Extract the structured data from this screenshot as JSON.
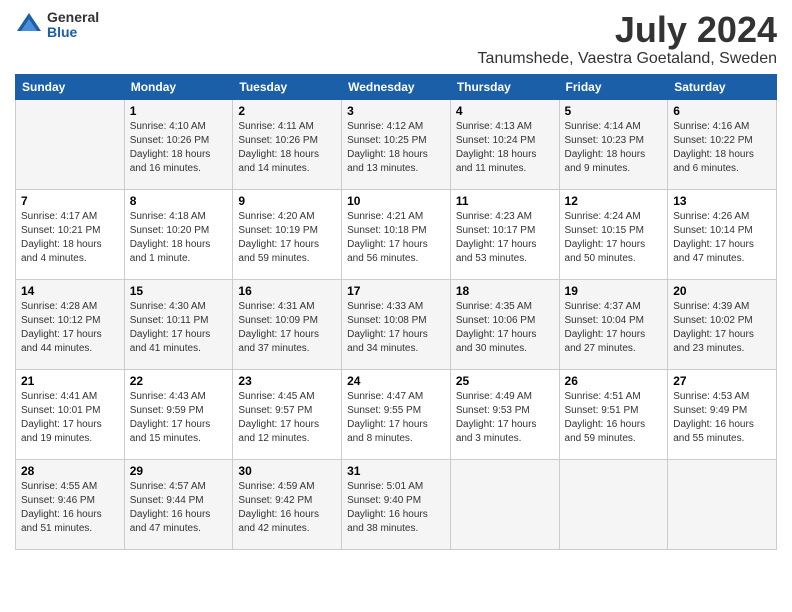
{
  "logo": {
    "general": "General",
    "blue": "Blue"
  },
  "title": {
    "month": "July 2024",
    "location": "Tanumshede, Vaestra Goetaland, Sweden"
  },
  "weekdays": [
    "Sunday",
    "Monday",
    "Tuesday",
    "Wednesday",
    "Thursday",
    "Friday",
    "Saturday"
  ],
  "weeks": [
    [
      {
        "day": "",
        "info": ""
      },
      {
        "day": "1",
        "info": "Sunrise: 4:10 AM\nSunset: 10:26 PM\nDaylight: 18 hours\nand 16 minutes."
      },
      {
        "day": "2",
        "info": "Sunrise: 4:11 AM\nSunset: 10:26 PM\nDaylight: 18 hours\nand 14 minutes."
      },
      {
        "day": "3",
        "info": "Sunrise: 4:12 AM\nSunset: 10:25 PM\nDaylight: 18 hours\nand 13 minutes."
      },
      {
        "day": "4",
        "info": "Sunrise: 4:13 AM\nSunset: 10:24 PM\nDaylight: 18 hours\nand 11 minutes."
      },
      {
        "day": "5",
        "info": "Sunrise: 4:14 AM\nSunset: 10:23 PM\nDaylight: 18 hours\nand 9 minutes."
      },
      {
        "day": "6",
        "info": "Sunrise: 4:16 AM\nSunset: 10:22 PM\nDaylight: 18 hours\nand 6 minutes."
      }
    ],
    [
      {
        "day": "7",
        "info": "Sunrise: 4:17 AM\nSunset: 10:21 PM\nDaylight: 18 hours\nand 4 minutes."
      },
      {
        "day": "8",
        "info": "Sunrise: 4:18 AM\nSunset: 10:20 PM\nDaylight: 18 hours\nand 1 minute."
      },
      {
        "day": "9",
        "info": "Sunrise: 4:20 AM\nSunset: 10:19 PM\nDaylight: 17 hours\nand 59 minutes."
      },
      {
        "day": "10",
        "info": "Sunrise: 4:21 AM\nSunset: 10:18 PM\nDaylight: 17 hours\nand 56 minutes."
      },
      {
        "day": "11",
        "info": "Sunrise: 4:23 AM\nSunset: 10:17 PM\nDaylight: 17 hours\nand 53 minutes."
      },
      {
        "day": "12",
        "info": "Sunrise: 4:24 AM\nSunset: 10:15 PM\nDaylight: 17 hours\nand 50 minutes."
      },
      {
        "day": "13",
        "info": "Sunrise: 4:26 AM\nSunset: 10:14 PM\nDaylight: 17 hours\nand 47 minutes."
      }
    ],
    [
      {
        "day": "14",
        "info": "Sunrise: 4:28 AM\nSunset: 10:12 PM\nDaylight: 17 hours\nand 44 minutes."
      },
      {
        "day": "15",
        "info": "Sunrise: 4:30 AM\nSunset: 10:11 PM\nDaylight: 17 hours\nand 41 minutes."
      },
      {
        "day": "16",
        "info": "Sunrise: 4:31 AM\nSunset: 10:09 PM\nDaylight: 17 hours\nand 37 minutes."
      },
      {
        "day": "17",
        "info": "Sunrise: 4:33 AM\nSunset: 10:08 PM\nDaylight: 17 hours\nand 34 minutes."
      },
      {
        "day": "18",
        "info": "Sunrise: 4:35 AM\nSunset: 10:06 PM\nDaylight: 17 hours\nand 30 minutes."
      },
      {
        "day": "19",
        "info": "Sunrise: 4:37 AM\nSunset: 10:04 PM\nDaylight: 17 hours\nand 27 minutes."
      },
      {
        "day": "20",
        "info": "Sunrise: 4:39 AM\nSunset: 10:02 PM\nDaylight: 17 hours\nand 23 minutes."
      }
    ],
    [
      {
        "day": "21",
        "info": "Sunrise: 4:41 AM\nSunset: 10:01 PM\nDaylight: 17 hours\nand 19 minutes."
      },
      {
        "day": "22",
        "info": "Sunrise: 4:43 AM\nSunset: 9:59 PM\nDaylight: 17 hours\nand 15 minutes."
      },
      {
        "day": "23",
        "info": "Sunrise: 4:45 AM\nSunset: 9:57 PM\nDaylight: 17 hours\nand 12 minutes."
      },
      {
        "day": "24",
        "info": "Sunrise: 4:47 AM\nSunset: 9:55 PM\nDaylight: 17 hours\nand 8 minutes."
      },
      {
        "day": "25",
        "info": "Sunrise: 4:49 AM\nSunset: 9:53 PM\nDaylight: 17 hours\nand 3 minutes."
      },
      {
        "day": "26",
        "info": "Sunrise: 4:51 AM\nSunset: 9:51 PM\nDaylight: 16 hours\nand 59 minutes."
      },
      {
        "day": "27",
        "info": "Sunrise: 4:53 AM\nSunset: 9:49 PM\nDaylight: 16 hours\nand 55 minutes."
      }
    ],
    [
      {
        "day": "28",
        "info": "Sunrise: 4:55 AM\nSunset: 9:46 PM\nDaylight: 16 hours\nand 51 minutes."
      },
      {
        "day": "29",
        "info": "Sunrise: 4:57 AM\nSunset: 9:44 PM\nDaylight: 16 hours\nand 47 minutes."
      },
      {
        "day": "30",
        "info": "Sunrise: 4:59 AM\nSunset: 9:42 PM\nDaylight: 16 hours\nand 42 minutes."
      },
      {
        "day": "31",
        "info": "Sunrise: 5:01 AM\nSunset: 9:40 PM\nDaylight: 16 hours\nand 38 minutes."
      },
      {
        "day": "",
        "info": ""
      },
      {
        "day": "",
        "info": ""
      },
      {
        "day": "",
        "info": ""
      }
    ]
  ]
}
